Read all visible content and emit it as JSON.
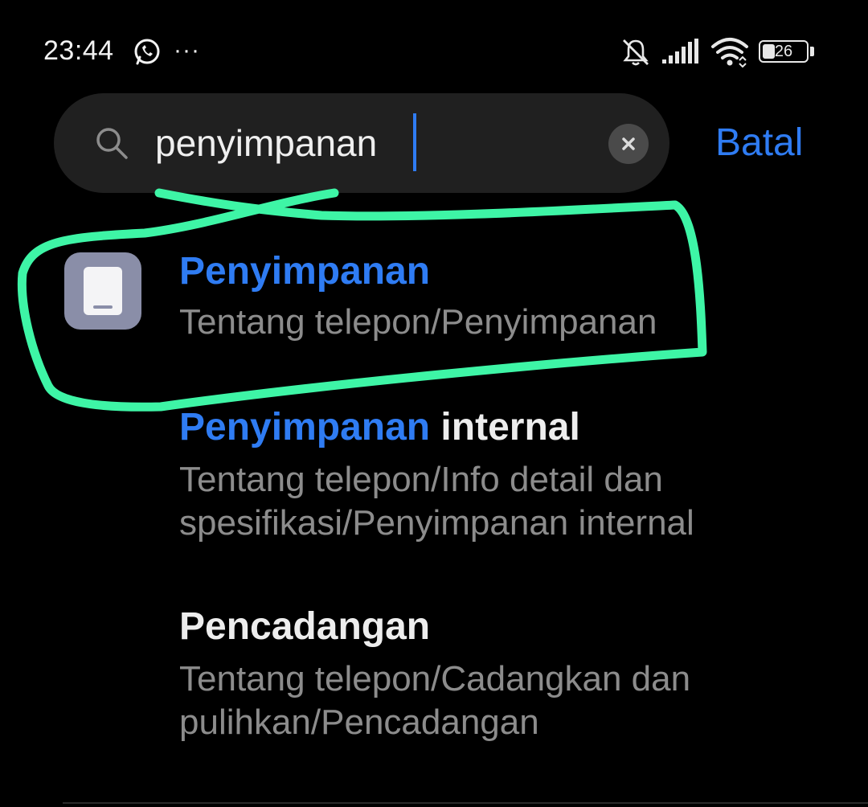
{
  "status_bar": {
    "time": "23:44",
    "more": "···",
    "battery_level": "26",
    "icons": [
      "whatsapp-icon",
      "more-icon",
      "mute-icon",
      "signal-icon",
      "wifi-icon",
      "battery-icon"
    ]
  },
  "search": {
    "value": "penyimpanan",
    "placeholder": "",
    "cancel_label": "Batal"
  },
  "results": [
    {
      "title_highlight": "Penyimpanan",
      "title_rest": "",
      "path": "Tentang telepon/Penyimpanan",
      "icon": "storage-icon"
    },
    {
      "title_highlight": "Penyimpanan",
      "title_rest": " internal",
      "path": "Tentang telepon/Info detail dan spesifikasi/Penyimpanan internal"
    },
    {
      "title_highlight": "",
      "title_rest": "Pencadangan",
      "path": "Tentang telepon/Cadangkan dan pulihkan/Pencadangan"
    }
  ],
  "colors": {
    "accent": "#2f7cf3",
    "annotation": "#3ef5a6",
    "background": "#000000"
  }
}
